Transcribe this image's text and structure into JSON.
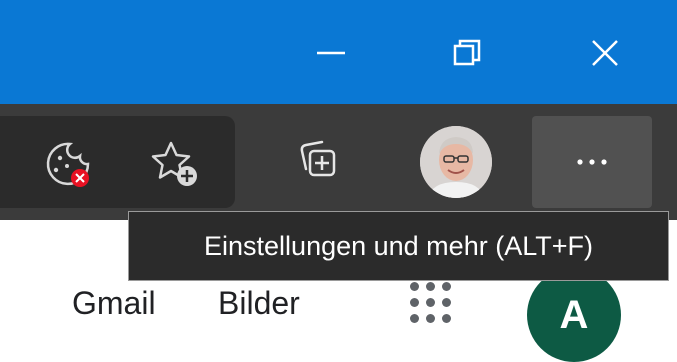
{
  "window_controls": {
    "minimize": "minimize",
    "restore": "restore",
    "close": "close"
  },
  "toolbar": {
    "icons": [
      "cookie-blocked-icon",
      "add-favorite-icon",
      "collections-icon",
      "profile-avatar",
      "more-icon"
    ],
    "more_label": "···"
  },
  "tooltip": {
    "text": "Einstellungen und mehr (ALT+F)"
  },
  "page": {
    "gmail_link": "Gmail",
    "images_link": "Bilder",
    "account_initial": "A",
    "account_color": "#0d5a44"
  },
  "colors": {
    "titlebar": "#0a78d4",
    "toolbar": "#3b3b3b",
    "badge_red": "#e81123"
  }
}
